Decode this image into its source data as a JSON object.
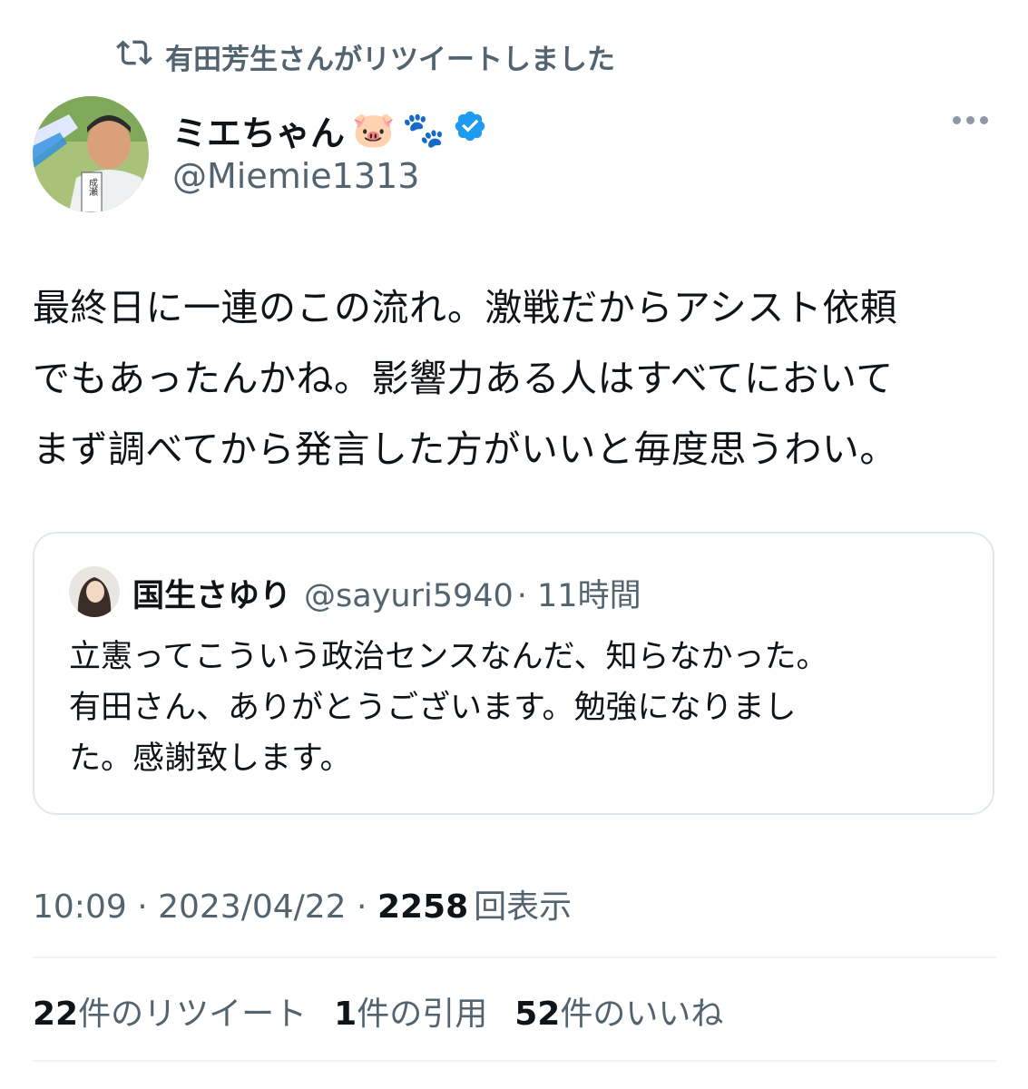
{
  "retweet_context": {
    "text": "有田芳生さんがリツイートしました"
  },
  "author": {
    "display_name": "ミエちゃん",
    "emoji_pig": "🐷",
    "emoji_paws": "🐾",
    "handle": "@Miemie1313",
    "avatar_text": "成瀬"
  },
  "tweet": {
    "text": "最終日に一連のこの流れ。激戦だからアシスト依頼\nでもあったんかね。影響力ある人はすべてにおいて\nまず調べてから発言した方がいいと毎度思うわい。"
  },
  "quote": {
    "name": "国生さゆり",
    "handle": "@sayuri5940",
    "time": "· 11時間",
    "text": "立憲ってこういう政治センスなんだ、知らなかった。\n有田さん、ありがとうございます。勉強になりまし\nた。感謝致します。"
  },
  "meta": {
    "time": "10:09",
    "sep1": " · ",
    "date": "2023/04/22",
    "sep2": " · ",
    "views": "2258",
    "views_label": "回表示"
  },
  "stats": {
    "retweets": "22",
    "retweets_label": "件のリツイート",
    "quotes": "1",
    "quotes_label": "件の引用",
    "likes": "52",
    "likes_label": "件のいいね"
  },
  "colors": {
    "verified": "#1d9bf0",
    "secondary_text": "#536471",
    "border": "#e1e8ed"
  }
}
